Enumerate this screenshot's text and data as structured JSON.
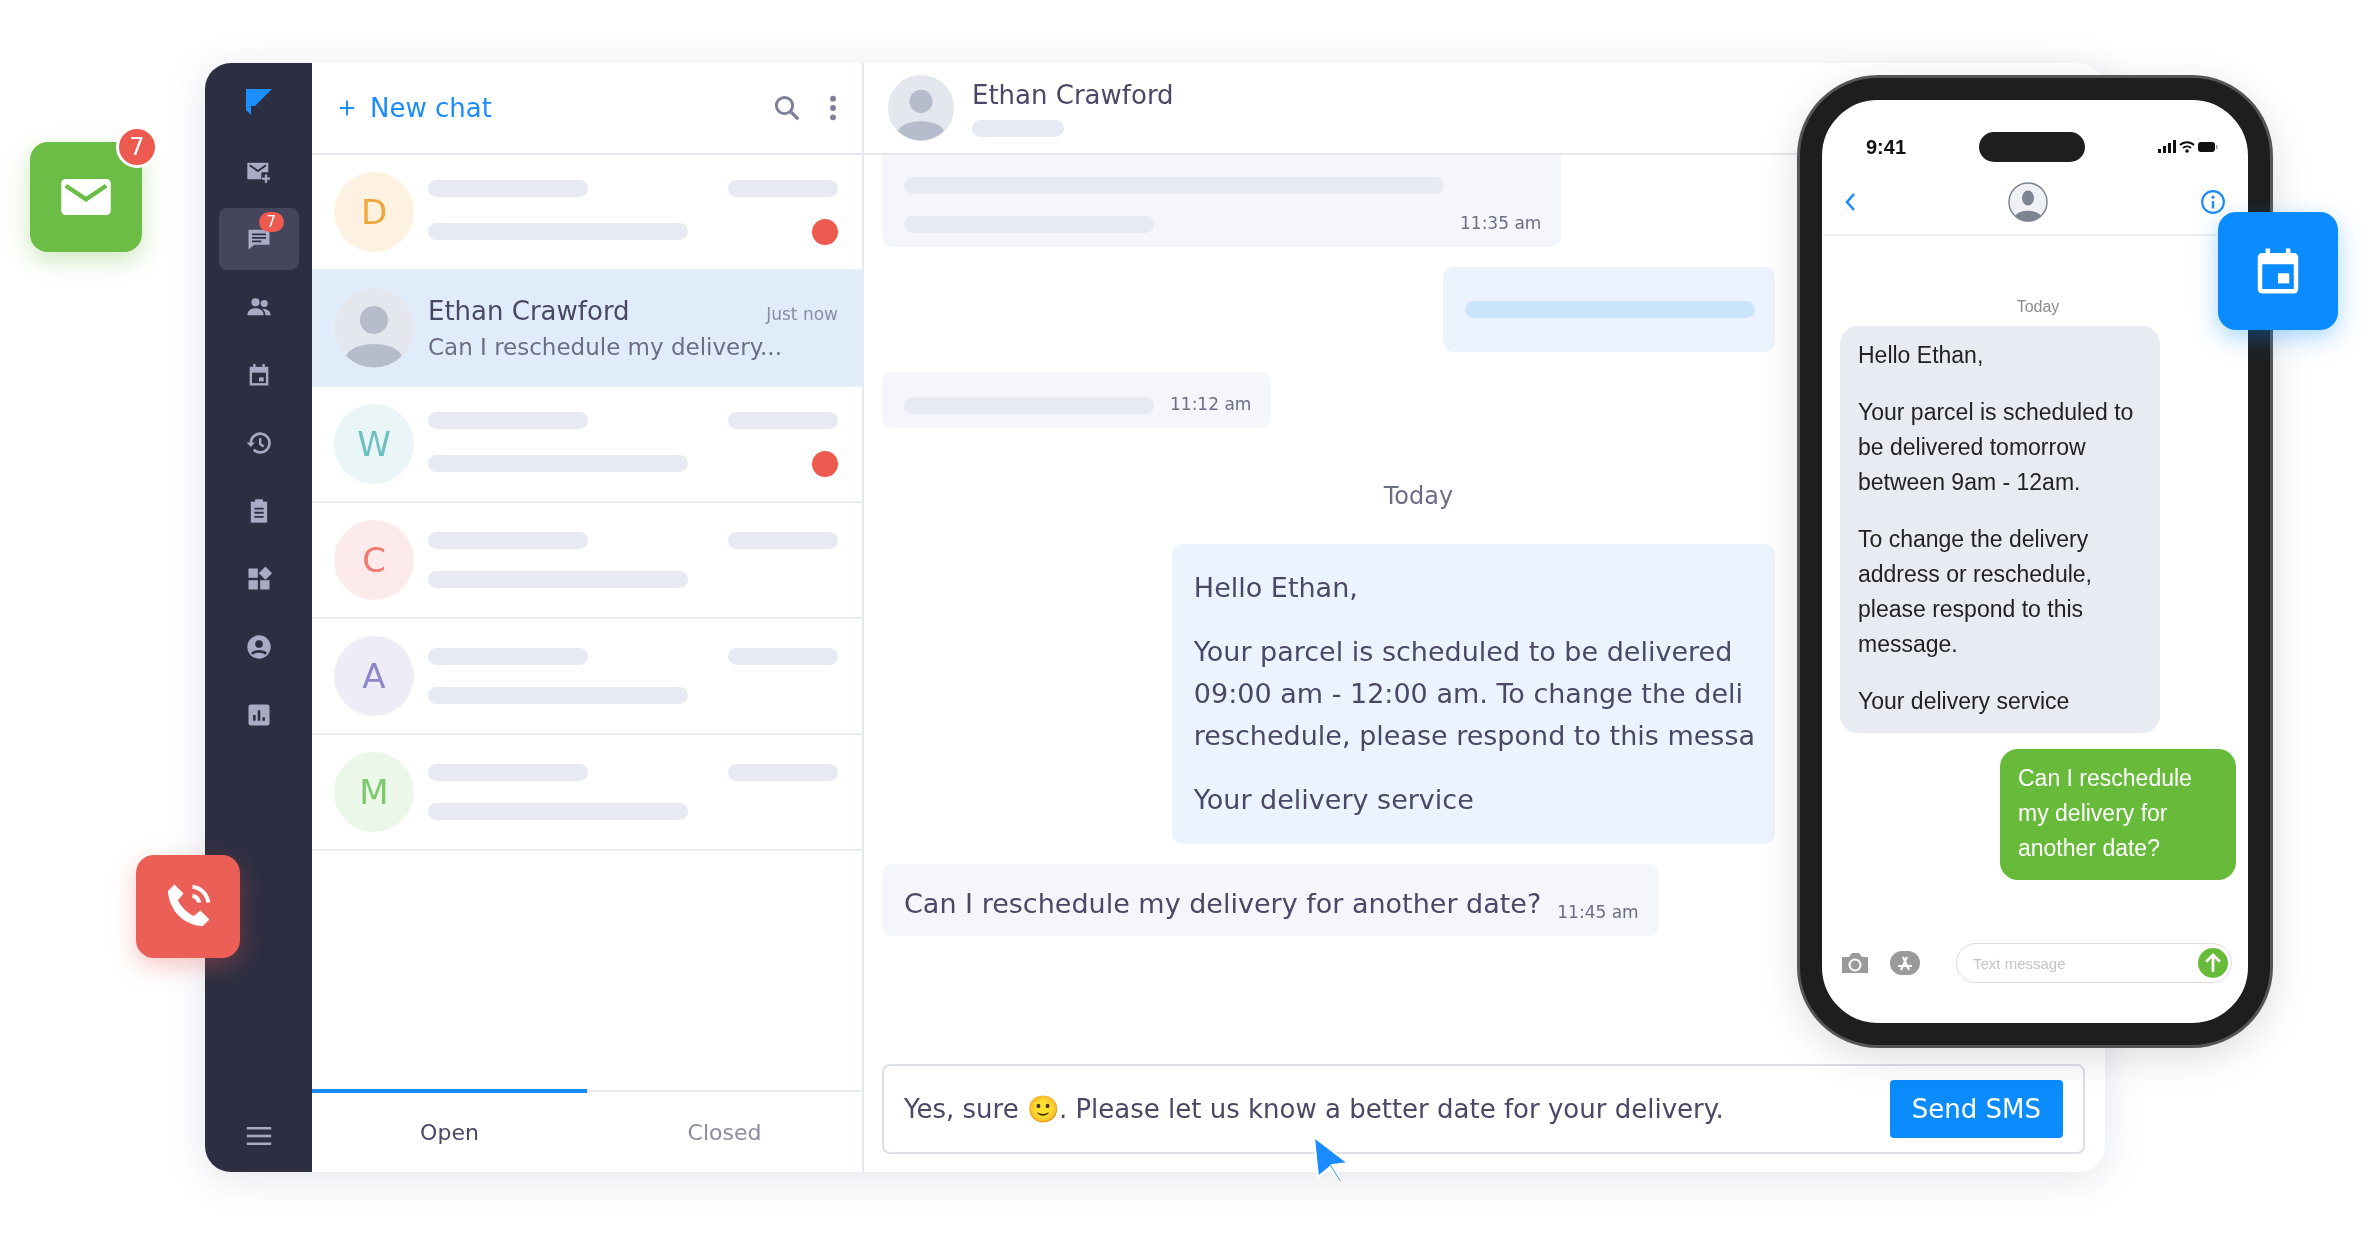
{
  "floating_icons": [
    {
      "kind": "mail",
      "badge": "7"
    },
    {
      "kind": "phone"
    },
    {
      "kind": "calendar"
    }
  ],
  "sidebar": {
    "items": [
      {
        "kind": "mail-plus",
        "selected": false
      },
      {
        "kind": "chat",
        "selected": true,
        "badge": "7"
      },
      {
        "kind": "people",
        "selected": false
      },
      {
        "kind": "calendar",
        "selected": false
      },
      {
        "kind": "history",
        "selected": false
      },
      {
        "kind": "clipboard",
        "selected": false
      },
      {
        "kind": "widgets",
        "selected": false
      },
      {
        "kind": "account",
        "selected": false
      },
      {
        "kind": "chart",
        "selected": false
      }
    ]
  },
  "chat_list": {
    "new_chat": "New chat",
    "conversations": [
      {
        "kind": "skeleton",
        "initial": "D",
        "color": "#f0a63c",
        "unread": true,
        "selected": false
      },
      {
        "kind": "contact",
        "name": "Ethan Crawford",
        "time": "Just now",
        "preview": "Can I reschedule my delivery...",
        "selected": true
      },
      {
        "kind": "skeleton",
        "initial": "W",
        "color": "#6dbfc0",
        "unread": true,
        "selected": false
      },
      {
        "kind": "skeleton",
        "initial": "C",
        "color": "#ee7b70",
        "unread": false,
        "selected": false
      },
      {
        "kind": "skeleton",
        "initial": "A",
        "color": "#8d86c8",
        "unread": false,
        "selected": false
      },
      {
        "kind": "skeleton",
        "initial": "M",
        "color": "#7cc96b",
        "unread": false,
        "selected": false
      }
    ],
    "tabs": [
      {
        "label": "Open",
        "selected": true
      },
      {
        "label": "Closed",
        "selected": false
      }
    ]
  },
  "chat": {
    "contact": "Ethan Crawford",
    "messages": [
      {
        "kind": "skeleton-double",
        "outgoing": false,
        "time": "11:35 am"
      },
      {
        "kind": "skeleton-single",
        "outgoing": true
      },
      {
        "kind": "skeleton-single",
        "outgoing": false,
        "time": "11:12 am"
      },
      {
        "kind": "date",
        "text": "Today"
      },
      {
        "kind": "text",
        "outgoing": true,
        "paragraphs": [
          [
            "Hello Ethan,"
          ],
          [
            "Your parcel is scheduled to be delivered",
            "09:00 am - 12:00 am. To change the deli",
            "reschedule, please respond to this messa"
          ],
          [
            "Your delivery service"
          ]
        ]
      },
      {
        "kind": "text",
        "outgoing": false,
        "paragraphs": [
          [
            "Can I reschedule my delivery for another date?"
          ]
        ],
        "time": "11:45 am"
      }
    ],
    "composer": {
      "value": "Yes, sure 🙂.  Please let us know a better date for your delivery.",
      "button": "Send SMS"
    }
  },
  "phone": {
    "time": "9:41",
    "date": "Today",
    "messages": [
      {
        "outgoing": false,
        "paragraphs": [
          "Hello Ethan,",
          "Your parcel is scheduled to be delivered tomorrow between 9am - 12am.",
          "To change the delivery address or reschedule, please respond to this message.",
          "Your delivery service"
        ]
      },
      {
        "outgoing": true,
        "paragraphs": [
          "Can I reschedule my delivery for another date?"
        ]
      }
    ],
    "placeholder": "Text message"
  }
}
